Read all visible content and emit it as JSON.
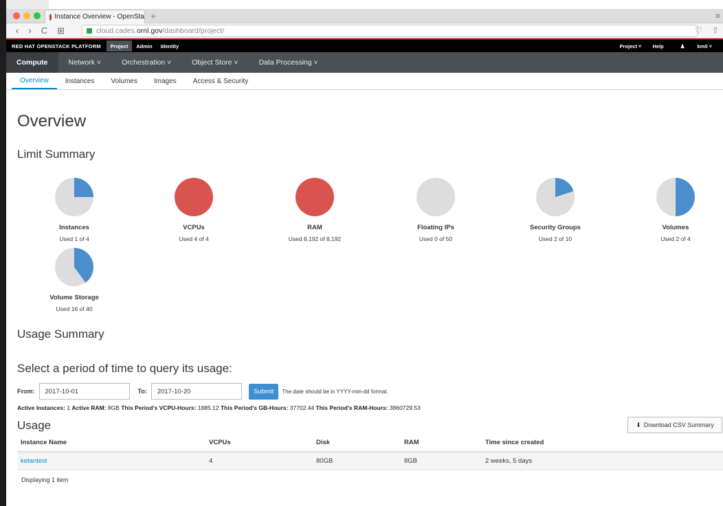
{
  "browser": {
    "tab_title": "Instance Overview - OpenSta",
    "url_prefix": "cloud.cades.",
    "url_domain": "ornl.gov",
    "url_path": "/dashboard/project/"
  },
  "topbar": {
    "brand": "RED HAT OPENSTACK PLATFORM",
    "nav": [
      "Project",
      "Admin",
      "Identity"
    ],
    "right": [
      "Project ˅",
      "Help",
      "km0 ˅"
    ]
  },
  "compute_nav": [
    "Compute",
    "Network ˅",
    "Orchestration ˅",
    "Object Store ˅",
    "Data Processing ˅"
  ],
  "sub_nav": [
    "Overview",
    "Instances",
    "Volumes",
    "Images",
    "Access & Security"
  ],
  "page_title": "Overview",
  "limit_summary_title": "Limit Summary",
  "limits": [
    {
      "label": "Instances",
      "used_text": "Used 1 of 4",
      "fraction": 0.25
    },
    {
      "label": "VCPUs",
      "used_text": "Used 4 of 4",
      "fraction": 1.0
    },
    {
      "label": "RAM",
      "used_text": "Used 8,192 of 8,192",
      "fraction": 1.0
    },
    {
      "label": "Floating IPs",
      "used_text": "Used 0 of 50",
      "fraction": 0.0
    },
    {
      "label": "Security Groups",
      "used_text": "Used 2 of 10",
      "fraction": 0.2
    },
    {
      "label": "Volumes",
      "used_text": "Used 2 of 4",
      "fraction": 0.5
    },
    {
      "label": "Volume Storage",
      "used_text": "Used 16 of 40",
      "fraction": 0.4
    }
  ],
  "colors": {
    "used": "#4a8ecd",
    "full": "#d9534f",
    "empty": "#dddddd"
  },
  "usage_summary_title": "Usage Summary",
  "period_title": "Select a period of time to query its usage:",
  "form": {
    "from_label": "From:",
    "from_value": "2017-10-01",
    "to_label": "To:",
    "to_value": "2017-10-20",
    "submit_label": "Submit",
    "hint": "The date should be in YYYY-mm-dd format."
  },
  "stats": {
    "active_instances_label": "Active Instances:",
    "active_instances": "1",
    "active_ram_label": "Active RAM:",
    "active_ram": "8GB",
    "vcpu_hours_label": "This Period's VCPU-Hours:",
    "vcpu_hours": "1885.12",
    "gb_hours_label": "This Period's GB-Hours:",
    "gb_hours": "37702.44",
    "ram_hours_label": "This Period's RAM-Hours:",
    "ram_hours": "3860729.53"
  },
  "usage_title": "Usage",
  "csv_button": "Download CSV Summary",
  "table": {
    "headers": [
      "Instance Name",
      "VCPUs",
      "Disk",
      "RAM",
      "Time since created"
    ],
    "rows": [
      [
        "ketantest",
        "4",
        "80GB",
        "8GB",
        "2 weeks, 5 days"
      ]
    ]
  },
  "footer_note": "Displaying 1 item"
}
